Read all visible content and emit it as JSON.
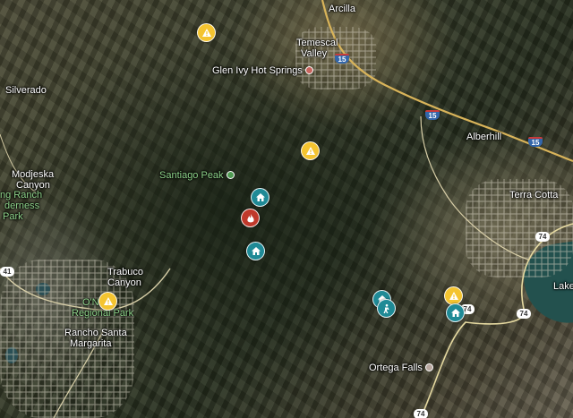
{
  "map": {
    "places": [
      {
        "id": "arcilla",
        "label": "Arcilla"
      },
      {
        "id": "temescal-1",
        "label": "Temescal"
      },
      {
        "id": "temescal-2",
        "label": "Valley"
      },
      {
        "id": "glen-ivy",
        "label": "Glen Ivy Hot Springs"
      },
      {
        "id": "silverado",
        "label": "Silverado"
      },
      {
        "id": "alberhill",
        "label": "Alberhill"
      },
      {
        "id": "terra-cotta",
        "label": "Terra Cotta"
      },
      {
        "id": "santiago-peak",
        "label": "Santiago Peak"
      },
      {
        "id": "modjeska",
        "label": "Modjeska"
      },
      {
        "id": "modjeska-2",
        "label": "Canyon"
      },
      {
        "id": "ranch",
        "label": "ng Ranch"
      },
      {
        "id": "wilderness",
        "label": "derness"
      },
      {
        "id": "park",
        "label": "Park"
      },
      {
        "id": "trabuco-1",
        "label": "Trabuco"
      },
      {
        "id": "trabuco-2",
        "label": "Canyon"
      },
      {
        "id": "oneill-1",
        "label": "O'N"
      },
      {
        "id": "oneill-2",
        "label": "Regional Park"
      },
      {
        "id": "rsm-1",
        "label": "Rancho Santa"
      },
      {
        "id": "rsm-2",
        "label": "Margarita"
      },
      {
        "id": "ortega",
        "label": "Ortega Falls"
      },
      {
        "id": "lake",
        "label": "Lake"
      }
    ],
    "shields": [
      {
        "id": "i15-a",
        "label": "15",
        "kind": "interstate"
      },
      {
        "id": "i15-b",
        "label": "15",
        "kind": "interstate"
      },
      {
        "id": "i15-c",
        "label": "15",
        "kind": "interstate"
      },
      {
        "id": "sr74-a",
        "label": "74",
        "kind": "state"
      },
      {
        "id": "sr74-b",
        "label": "74",
        "kind": "state"
      },
      {
        "id": "sr74-c",
        "label": "74",
        "kind": "state"
      },
      {
        "id": "sr74-d",
        "label": "74",
        "kind": "state"
      },
      {
        "id": "sr241",
        "label": "41",
        "kind": "state"
      }
    ],
    "markers": [
      {
        "id": "m1",
        "type": "warning",
        "color": "#f4c430",
        "icon": "warning-icon"
      },
      {
        "id": "m2",
        "type": "warning",
        "color": "#f4c430",
        "icon": "warning-icon"
      },
      {
        "id": "m3",
        "type": "home",
        "color": "#1f8a96",
        "icon": "home-icon"
      },
      {
        "id": "m4",
        "type": "fire",
        "color": "#c0392b",
        "icon": "fire-icon"
      },
      {
        "id": "m5",
        "type": "home",
        "color": "#1f8a96",
        "icon": "home-icon"
      },
      {
        "id": "m6",
        "type": "warning",
        "color": "#f4c430",
        "icon": "warning-icon"
      },
      {
        "id": "m7",
        "type": "home",
        "color": "#1f8a96",
        "icon": "home-icon"
      },
      {
        "id": "m8",
        "type": "evacuation",
        "color": "#1f8a96",
        "icon": "evacuation-icon"
      },
      {
        "id": "m9",
        "type": "warning",
        "color": "#f4c430",
        "icon": "warning-icon"
      },
      {
        "id": "m10",
        "type": "home",
        "color": "#1f8a96",
        "icon": "home-icon"
      }
    ]
  }
}
